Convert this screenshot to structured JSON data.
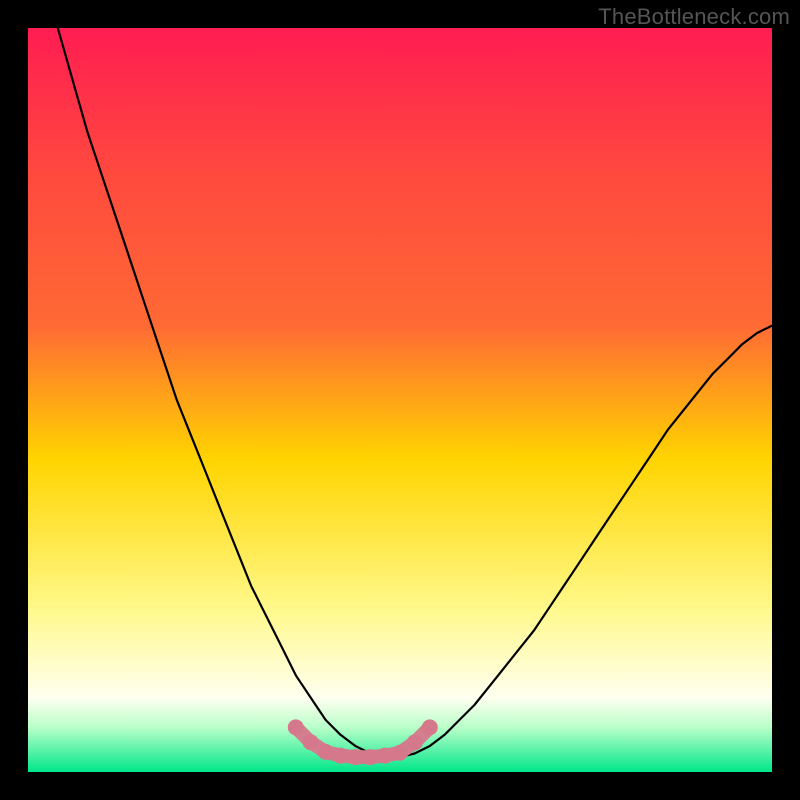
{
  "watermark": "TheBottleneck.com",
  "colors": {
    "frame": "#000000",
    "gradient_top": "#ff1d52",
    "gradient_mid1": "#ff6a34",
    "gradient_mid2": "#ffd400",
    "gradient_mid3": "#fff98a",
    "gradient_mid4": "#fffff0",
    "gradient_mid5": "#b9ffc9",
    "gradient_bottom": "#00e68a",
    "curve": "#000000",
    "marker": "#d6788c"
  },
  "chart_data": {
    "type": "line",
    "title": "",
    "xlabel": "",
    "ylabel": "",
    "xlim": [
      0,
      100
    ],
    "ylim": [
      0,
      100
    ],
    "x": [
      4,
      6,
      8,
      10,
      12,
      14,
      16,
      18,
      20,
      22,
      24,
      26,
      28,
      30,
      32,
      34,
      36,
      38,
      40,
      42,
      44,
      46,
      48,
      50,
      52,
      54,
      56,
      58,
      60,
      62,
      64,
      66,
      68,
      70,
      72,
      74,
      76,
      78,
      80,
      82,
      84,
      86,
      88,
      90,
      92,
      94,
      96,
      98,
      100
    ],
    "values": [
      100,
      93,
      86,
      80,
      74,
      68,
      62,
      56,
      50,
      45,
      40,
      35,
      30,
      25,
      21,
      17,
      13,
      10,
      7,
      5,
      3.5,
      2.5,
      2,
      2,
      2.5,
      3.5,
      5,
      7,
      9,
      11.5,
      14,
      16.5,
      19,
      22,
      25,
      28,
      31,
      34,
      37,
      40,
      43,
      46,
      48.5,
      51,
      53.5,
      55.5,
      57.5,
      59,
      60
    ],
    "series": [
      {
        "name": "bottleneck-curve",
        "values_ref": "values"
      }
    ],
    "markers": {
      "x": [
        36,
        38,
        40,
        42,
        44,
        46,
        48,
        50,
        52,
        54
      ],
      "y": [
        6,
        4,
        2.7,
        2.2,
        2,
        2,
        2.2,
        2.6,
        4,
        6
      ]
    }
  }
}
